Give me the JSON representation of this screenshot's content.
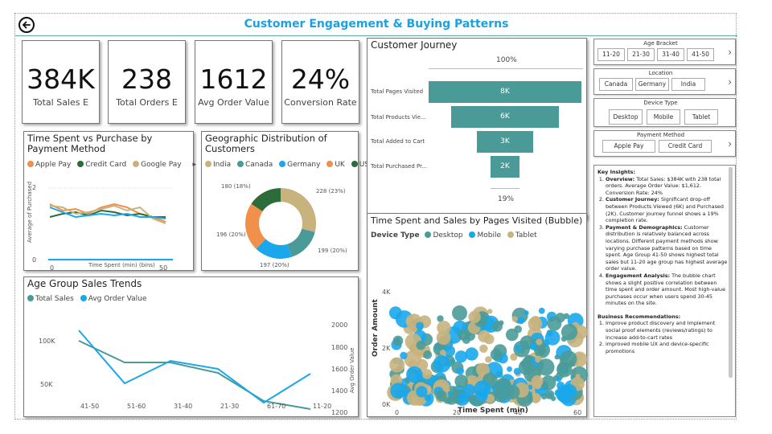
{
  "title": "Customer Engagement & Buying Patterns",
  "kpis": [
    {
      "value": "384K",
      "label": "Total Sales E"
    },
    {
      "value": "238",
      "label": "Total Orders E"
    },
    {
      "value": "1612",
      "label": "Avg Order Value"
    },
    {
      "value": "24%",
      "label": "Conversion Rate"
    }
  ],
  "time_spent_chart": {
    "title": "Time Spent vs Purchase by Payment Method",
    "legend": [
      "Apple Pay",
      "Credit Card",
      "Google Pay"
    ],
    "ylabel": "Average of Purchased",
    "xlabel": "Time Spent (min) (bins)",
    "yticks": [
      "2",
      "0"
    ],
    "xticks": [
      "0",
      "50"
    ]
  },
  "geo_chart": {
    "title": "Geographic Distribution of Customers",
    "legend": [
      "India",
      "Canada",
      "Germany",
      "UK",
      "USA"
    ],
    "labels": [
      "228 (23%)",
      "199 (20%)",
      "197 (20%)",
      "196 (20%)",
      "180 (18%)"
    ]
  },
  "age_chart": {
    "title": "Age Group Sales Trends",
    "legend": [
      "Total Sales",
      "Avg Order Value"
    ],
    "yticks_left": [
      "100K",
      "50K"
    ],
    "yticks_right": [
      "2000",
      "1800",
      "1600",
      "1400",
      "1200"
    ],
    "ylabel_right": "Avg Order Value",
    "categories": [
      "41-50",
      "51-60",
      "31-40",
      "21-30",
      "61-70",
      "11-20"
    ]
  },
  "journey": {
    "title": "Customer Journey",
    "top_pct": "100%",
    "bottom_pct": "19%",
    "stages": [
      {
        "label": "Total Pages Visited",
        "value": "8K"
      },
      {
        "label": "Total Products Vie...",
        "value": "6K"
      },
      {
        "label": "Total Added to Cart",
        "value": "3K"
      },
      {
        "label": "Total Purchased Pr...",
        "value": "2K"
      }
    ]
  },
  "bubble": {
    "title": "Time Spent and Sales by Pages Visited (Bubble)",
    "legend_title": "Device Type",
    "legend": [
      "Desktop",
      "Mobile",
      "Tablet"
    ],
    "ylabel": "Order Amount",
    "xlabel": "Time Spent (min)",
    "yticks": [
      "4K",
      "2K",
      "0K"
    ],
    "xticks": [
      "0",
      "20",
      "40",
      "60"
    ]
  },
  "slicers": [
    {
      "title": "Age Bracket",
      "options": [
        "11-20",
        "21-30",
        "31-40",
        "41-50"
      ]
    },
    {
      "title": "Location",
      "options": [
        "Canada",
        "Germany",
        "India"
      ]
    },
    {
      "title": "Device Type",
      "options": [
        "Desktop",
        "Mobile",
        "Tablet"
      ]
    },
    {
      "title": "Payment Method",
      "options": [
        "Apple Pay",
        "Credit Card"
      ]
    }
  ],
  "insights": {
    "heading": "Key Insights:",
    "items": [
      {
        "h": "Overview:",
        "t": " Total Sales: $384K with 238 total orders. Average Order Value: $1,612. Conversion Rate: 24%"
      },
      {
        "h": "Customer Journey:",
        "t": " Significant drop-off between Products Viewed (6K) and Purchased (2K). Customer journey funnel shows a 19% completion rate."
      },
      {
        "h": "Payment & Demographics:",
        "t": " Customer distribution is relatively balanced across locations. Different payment methods show varying purchase patterns based on time spent. Age Group 41-50 shows highest total sales but 11-20 age group has highest average order value."
      },
      {
        "h": "Engagement Analysis:",
        "t": " The bubble chart shows a slight positive correlation between time spent and order amount. Most high-value purchases occur when users spend 30-45 minutes on the site."
      }
    ],
    "rec_heading": "Business Recommendations:",
    "recs": [
      "Improve product discovery and Implement social proof elements (reviews/ratings) to increase add-to-cart rates",
      "improved mobile UX and device-specific promotions"
    ]
  },
  "colors": {
    "teal": "#4a9b98",
    "blue": "#1aa7ec",
    "tan": "#c8b27e",
    "orange": "#f0904a",
    "darkgreen": "#2e6b3a",
    "title": "#1ba1e2"
  }
}
